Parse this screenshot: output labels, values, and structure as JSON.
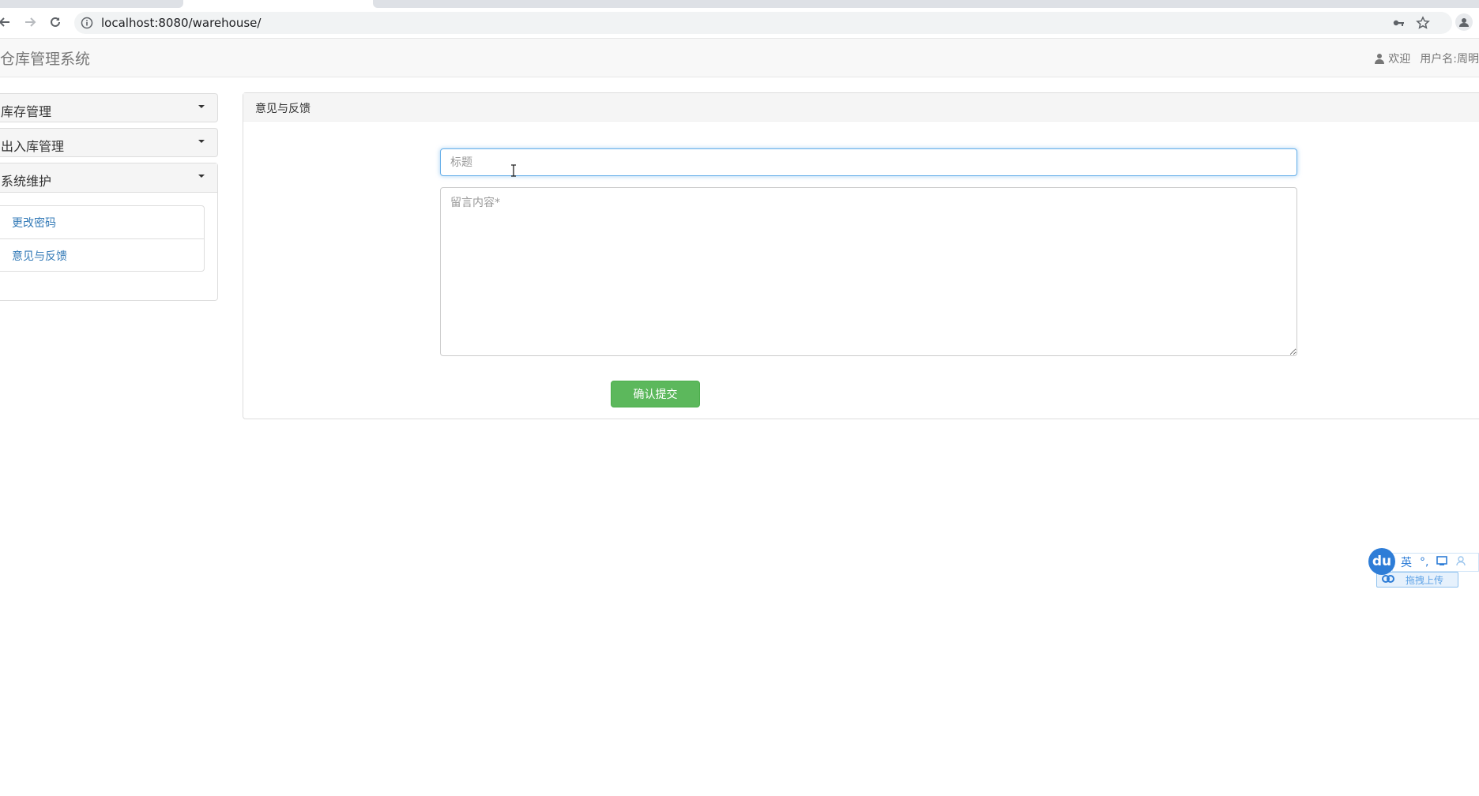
{
  "browser": {
    "url": "localhost:8080/warehouse/"
  },
  "app": {
    "brand": "仓库管理系统",
    "welcome": "欢迎",
    "user_label": "用户名:周明"
  },
  "sidebar": {
    "sections": [
      {
        "label": "库存管理",
        "expanded": false
      },
      {
        "label": "出入库管理",
        "expanded": false
      },
      {
        "label": "系统维护",
        "expanded": true
      }
    ],
    "items": [
      {
        "label": "更改密码"
      },
      {
        "label": "意见与反馈"
      }
    ]
  },
  "main": {
    "panel_title": "意见与反馈",
    "title_placeholder": "标题",
    "title_value": "",
    "content_placeholder": "留言内容*",
    "content_value": "",
    "submit_label": "确认提交"
  },
  "ime_toolbar": {
    "logo": "du",
    "lang": "英",
    "upload_label": "拖拽上传"
  },
  "colors": {
    "submit_green": "#5cb85c",
    "link_blue": "#337ab7",
    "focus_border": "#66afe9",
    "navbar_bg": "#f8f8f8"
  }
}
